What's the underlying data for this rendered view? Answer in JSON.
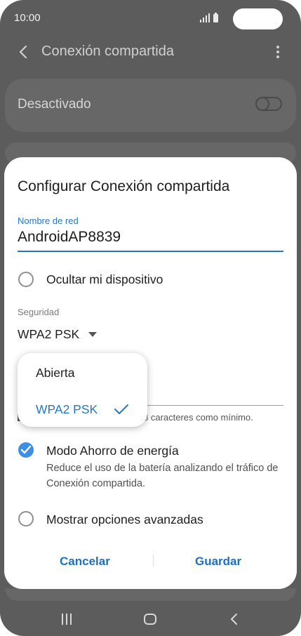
{
  "status": {
    "time": "10:00"
  },
  "appbar": {
    "title": "Conexión compartida"
  },
  "background": {
    "toggle_label": "Desactivado"
  },
  "dialog": {
    "title": "Configurar Conexión compartida",
    "network_name_label": "Nombre de red",
    "network_name_value": "AndroidAP8839",
    "hide_device_label": "Ocultar mi dispositivo",
    "security_label": "Seguridad",
    "security_value": "WPA2 PSK",
    "password_hint": "8 caracteres como mínimo.",
    "power_saving_label": "Modo Ahorro de energía",
    "power_saving_desc": "Reduce el uso de la batería analizando el tráfico de Conexión compartida.",
    "power_saving_checked": true,
    "advanced_label": "Mostrar opciones avanzadas",
    "cancel_label": "Cancelar",
    "save_label": "Guardar"
  },
  "dropdown": {
    "options": [
      "Abierta",
      "WPA2 PSK"
    ],
    "selected": "WPA2 PSK"
  },
  "colors": {
    "accent": "#3e8ee6",
    "button_text": "#1f6fc0",
    "scrim": "#5c5c5c"
  },
  "icons": {
    "back": "back-arrow-icon",
    "more": "more-vert-icon",
    "caret": "caret-down-icon",
    "check": "checkmark-icon",
    "nav_recents": "recents-icon",
    "nav_home": "home-icon",
    "nav_back": "nav-back-icon"
  }
}
